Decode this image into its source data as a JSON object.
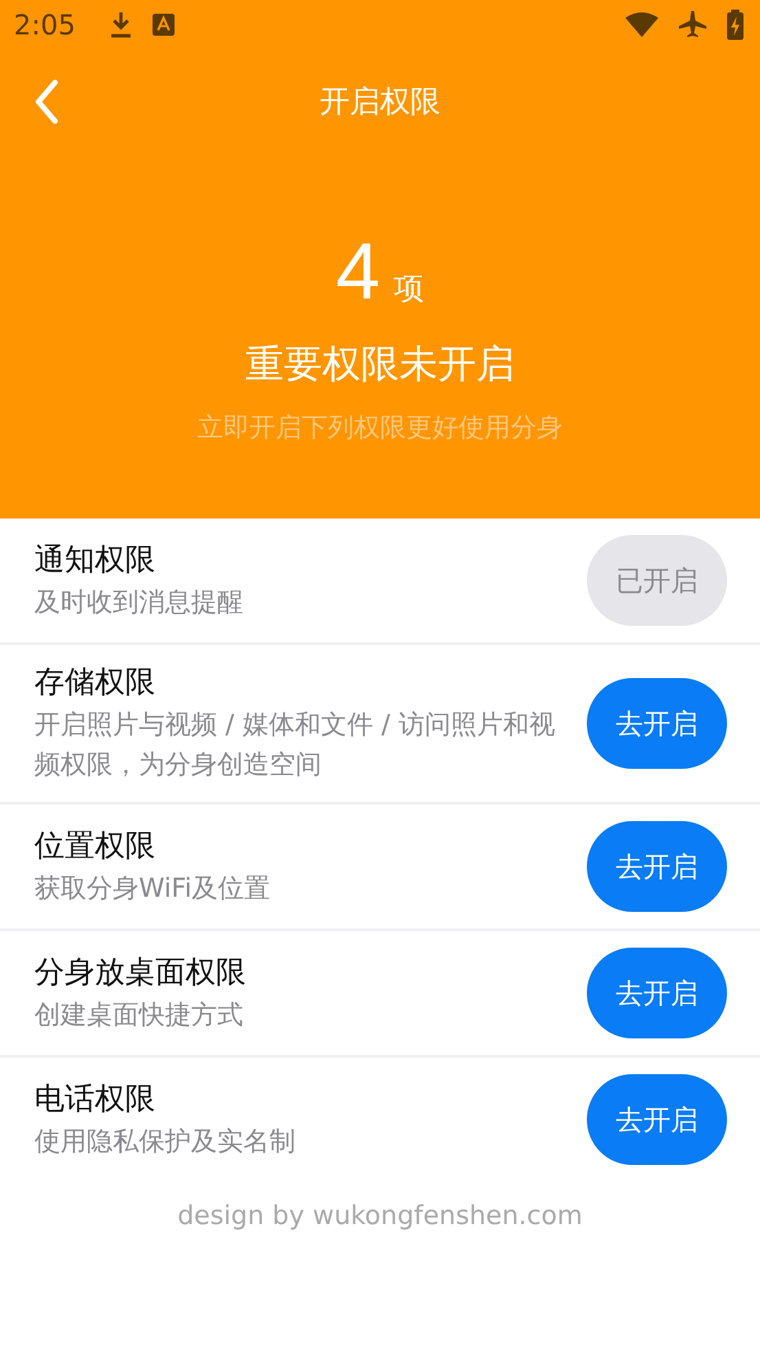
{
  "status_bar": {
    "time": "2:05"
  },
  "header": {
    "title": "开启权限"
  },
  "summary": {
    "count": "4",
    "unit": "项",
    "title": "重要权限未开启",
    "subtitle": "立即开启下列权限更好使用分身"
  },
  "permissions": [
    {
      "title": "通知权限",
      "description": "及时收到消息提醒",
      "button": "已开启",
      "enabled": true
    },
    {
      "title": "存储权限",
      "description": "开启照片与视频 / 媒体和文件 / 访问照片和视频权限，为分身创造空间",
      "button": "去开启",
      "enabled": false
    },
    {
      "title": "位置权限",
      "description": "获取分身WiFi及位置",
      "button": "去开启",
      "enabled": false
    },
    {
      "title": "分身放桌面权限",
      "description": "创建桌面快捷方式",
      "button": "去开启",
      "enabled": false
    },
    {
      "title": "电话权限",
      "description": "使用隐私保护及实名制",
      "button": "去开启",
      "enabled": false
    }
  ],
  "footer": "design by wukongfenshen.com"
}
